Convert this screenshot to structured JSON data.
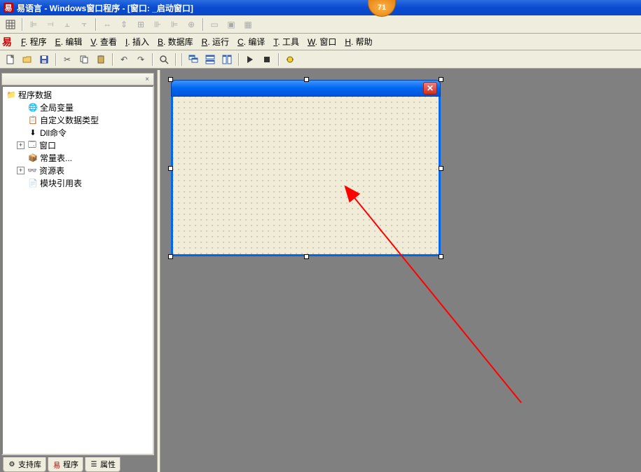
{
  "titlebar": {
    "title": "易语言 - Windows窗口程序 - [窗口: _启动窗口]"
  },
  "badge": {
    "number": "71"
  },
  "menus": [
    {
      "hotkey": "F",
      "label": ". 程序"
    },
    {
      "hotkey": "E",
      "label": ". 编辑"
    },
    {
      "hotkey": "V",
      "label": ". 查看"
    },
    {
      "hotkey": "I",
      "label": ". 插入"
    },
    {
      "hotkey": "B",
      "label": ". 数据库"
    },
    {
      "hotkey": "R",
      "label": ". 运行"
    },
    {
      "hotkey": "C",
      "label": ". 编译"
    },
    {
      "hotkey": "T",
      "label": ". 工具"
    },
    {
      "hotkey": "W",
      "label": ". 窗口"
    },
    {
      "hotkey": "H",
      "label": ". 帮助"
    }
  ],
  "tree": {
    "root": "程序数据",
    "items": [
      {
        "label": "全局变量",
        "icon": "globe"
      },
      {
        "label": "自定义数据类型",
        "icon": "type"
      },
      {
        "label": "Dll命令",
        "icon": "dll"
      },
      {
        "label": "窗口",
        "icon": "window",
        "expandable": true
      },
      {
        "label": "常量表...",
        "icon": "const"
      },
      {
        "label": "资源表",
        "icon": "res",
        "expandable": true
      },
      {
        "label": "模块引用表",
        "icon": "module"
      }
    ]
  },
  "bottom_tabs": [
    {
      "label": "支持库"
    },
    {
      "label": "程序"
    },
    {
      "label": "属性"
    }
  ],
  "toolbar3_icons": [
    "new",
    "open",
    "save",
    "|",
    "cut",
    "copy",
    "paste",
    "|",
    "undo",
    "redo",
    "|",
    "find",
    "|",
    "|",
    "win1",
    "win2",
    "win3",
    "|",
    "run",
    "stop",
    "|",
    "debug"
  ],
  "toolbar1_icons": [
    "layout",
    "|",
    "al1",
    "al2",
    "al3",
    "al4",
    "|",
    "sz1",
    "sz2",
    "sz3",
    "sz4",
    "sz5",
    "sz6",
    "|",
    "gr1",
    "gr2",
    "gr3"
  ]
}
